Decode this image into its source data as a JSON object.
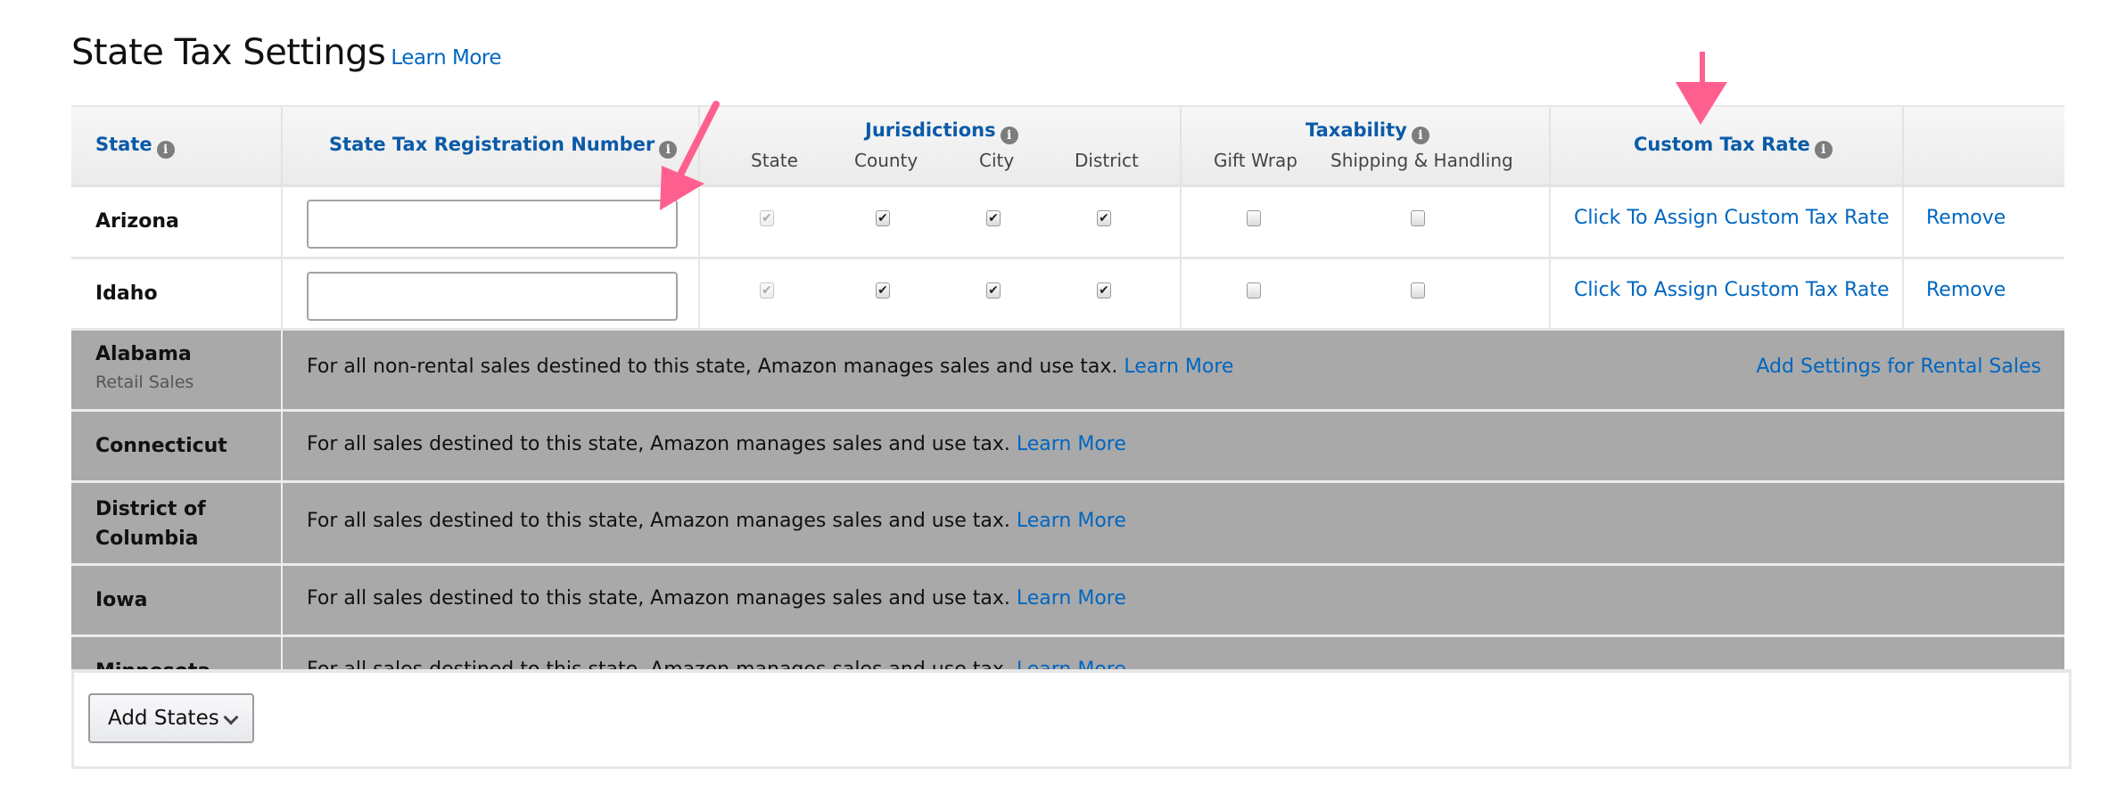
{
  "page": {
    "title": "State Tax Settings",
    "title_link": "Learn More"
  },
  "table": {
    "headers": {
      "state": "State",
      "registration": "State Tax Registration Number",
      "jurisdictions": "Jurisdictions",
      "jurisdiction_columns": [
        "State",
        "County",
        "City",
        "District"
      ],
      "taxability": "Taxability",
      "taxability_columns": [
        "Gift Wrap",
        "Shipping & Handling"
      ],
      "custom_rate": "Custom Tax Rate",
      "info_icon": "i"
    },
    "editable_rows": [
      {
        "state": "Arizona",
        "registration_number": "",
        "jurisdictions": {
          "state": true,
          "state_disabled": true,
          "county": true,
          "city": true,
          "district": true
        },
        "taxability": {
          "gift_wrap": false,
          "shipping_handling": false
        },
        "custom_rate_link": "Click To Assign Custom Tax Rate",
        "remove_link": "Remove"
      },
      {
        "state": "Idaho",
        "registration_number": "",
        "jurisdictions": {
          "state": true,
          "state_disabled": true,
          "county": true,
          "city": true,
          "district": true
        },
        "taxability": {
          "gift_wrap": false,
          "shipping_handling": false
        },
        "custom_rate_link": "Click To Assign Custom Tax Rate",
        "remove_link": "Remove"
      }
    ],
    "managed_rows": [
      {
        "state": "Alabama",
        "subtitle": "Retail Sales",
        "note": "For all non-rental sales destined to this state, Amazon manages sales and use tax.",
        "link": "Learn More",
        "right_link": "Add Settings for Rental Sales"
      },
      {
        "state": "Connecticut",
        "note": "For all sales destined to this state, Amazon manages sales and use tax.",
        "link": "Learn More"
      },
      {
        "state": "District of",
        "state_line2": "Columbia",
        "note": "For all sales destined to this state, Amazon manages sales and use tax.",
        "link": "Learn More"
      },
      {
        "state": "Iowa",
        "note": "For all sales destined to this state, Amazon manages sales and use tax.",
        "link": "Learn More"
      },
      {
        "state": "Minnesota",
        "note": "For all sales destined to this state, Amazon manages sales and use tax.",
        "link": "Learn More"
      }
    ]
  },
  "footer": {
    "add_states_label": "Add States"
  },
  "colors": {
    "link": "#0066c0",
    "header_link": "#0a5aa8",
    "managed_row_bg": "#a9a9a9",
    "annotation_arrow": "#ff5f8f"
  },
  "icons": {
    "info": "info-icon",
    "check": "✔",
    "dropdown": "chevron-down-icon"
  }
}
